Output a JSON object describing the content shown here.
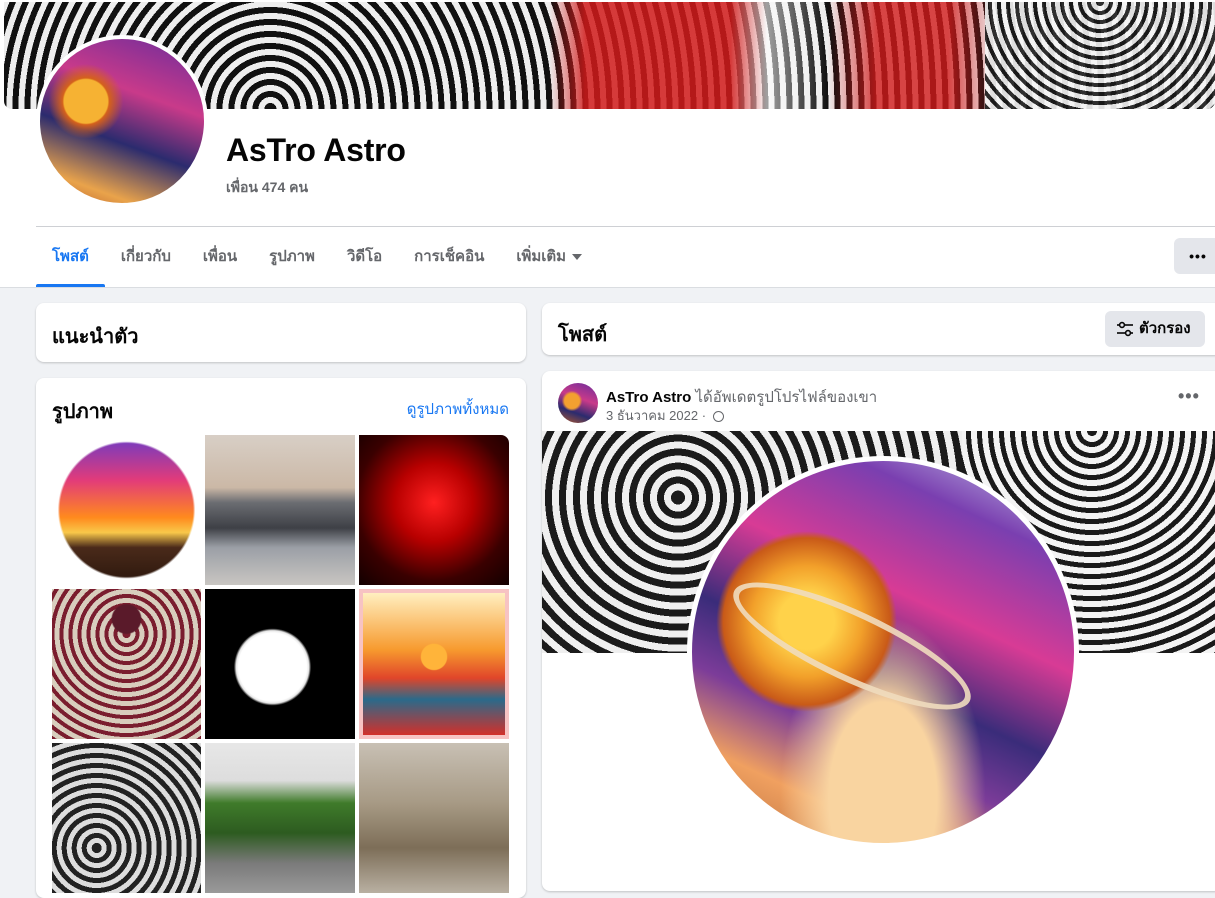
{
  "profile": {
    "name": "AsTro Astro",
    "friends_text": "เพื่อน 474 คน"
  },
  "tabs": [
    {
      "label": "โพสต์",
      "active": true
    },
    {
      "label": "เกี่ยวกับ"
    },
    {
      "label": "เพื่อน"
    },
    {
      "label": "รูปภาพ"
    },
    {
      "label": "วิดีโอ"
    },
    {
      "label": "การเช็คอิน"
    },
    {
      "label": "เพิ่มเติม"
    }
  ],
  "more_button": "•••",
  "intro": {
    "title": "แนะนำตัว"
  },
  "photos": {
    "title": "รูปภาพ",
    "see_all": "ดูรูปภาพทั้งหมด"
  },
  "posts_header": {
    "title": "โพสต์",
    "filter_label": "ตัวกรอง"
  },
  "post": {
    "author": "AsTro Astro",
    "action": "ได้อัพเดตรูปโปรไฟล์ของเขา",
    "date": "3 ธันวาคม 2022",
    "separator": "·",
    "more": "•••"
  },
  "colors": {
    "accent": "#1877f2",
    "secondary_text": "#65676b",
    "button_bg": "#e4e6eb"
  },
  "icons": {
    "filter": "sliders-icon",
    "privacy": "globe-icon",
    "dropdown": "caret-down-icon"
  }
}
